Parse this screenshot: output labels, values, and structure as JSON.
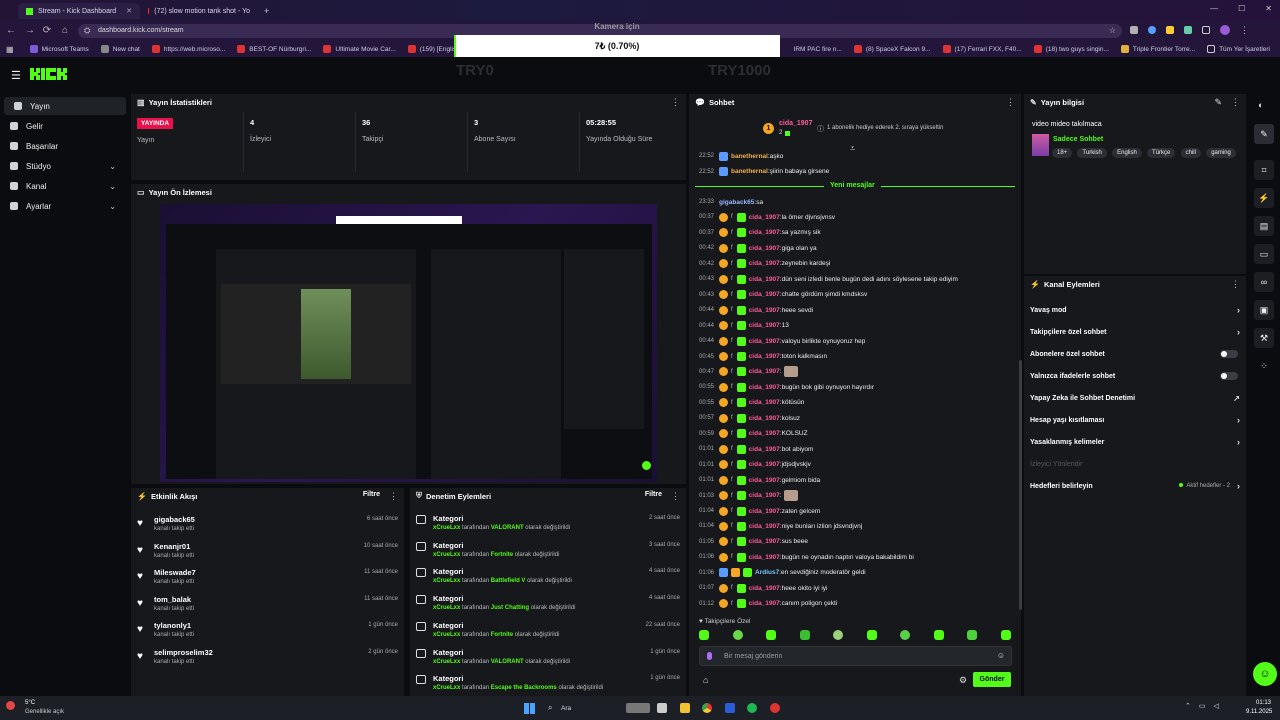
{
  "browser": {
    "tabs": [
      {
        "label": "Stream - Kick Dashboard",
        "active": true
      },
      {
        "label": "(72) slow motion tank shot - Yo",
        "active": false
      }
    ],
    "new_tab_label": "+",
    "url": "dashboard.kick.com/stream",
    "bookmarks": [
      "Microsoft Teams",
      "New chat",
      "https://web.microso...",
      "BEST-OF Nürburgri...",
      "Ultimate Movie Car...",
      "(159) [EnglishSUB]...",
      "IRM PAC fire n...",
      "(8) SpaceX Falcon 9...",
      "(17) Ferrari FXX, F40...",
      "(18) two guys singin...",
      "Triple Frontier Torre..."
    ],
    "all_bookmarks": "Tüm Yer İşaretleri"
  },
  "overlay": {
    "goal_label": "Kamera için",
    "goal_value": "7₺ (0.70%)",
    "goal_progress_fraction": 0.007,
    "left_amount": "TRY0",
    "right_amount": "TRY1000"
  },
  "sidebar": {
    "items": [
      {
        "label": "Yayın",
        "active": true,
        "has_chevron": false
      },
      {
        "label": "Gelir",
        "active": false,
        "has_chevron": false
      },
      {
        "label": "Başarılar",
        "active": false,
        "has_chevron": false
      },
      {
        "label": "Stüdyo",
        "active": false,
        "has_chevron": true
      },
      {
        "label": "Kanal",
        "active": false,
        "has_chevron": true
      },
      {
        "label": "Ayarlar",
        "active": false,
        "has_chevron": true
      }
    ]
  },
  "stats": {
    "title": "Yayın İstatistikleri",
    "live_badge": "YAYINDA",
    "items": [
      {
        "value": "",
        "label": "Yayın"
      },
      {
        "value": "4",
        "label": "İzleyici"
      },
      {
        "value": "36",
        "label": "Takipçi"
      },
      {
        "value": "3",
        "label": "Abone Sayısı"
      },
      {
        "value": "05:28:55",
        "label": "Yayında Olduğu Süre"
      }
    ]
  },
  "preview": {
    "title": "Yayın Ön İzlemesi"
  },
  "events": {
    "title": "Etkinlik Akışı",
    "filter": "Filtre",
    "items": [
      {
        "name": "gigaback65",
        "action": "kanalı takip etti",
        "time": "6 saat önce"
      },
      {
        "name": "Kenanjr01",
        "action": "kanalı takip etti",
        "time": "10 saat önce"
      },
      {
        "name": "Mileswade7",
        "action": "kanalı takip etti",
        "time": "11 saat önce"
      },
      {
        "name": "tom_balak",
        "action": "kanalı takip etti",
        "time": "11 saat önce"
      },
      {
        "name": "tylanonly1",
        "action": "kanalı takip etti",
        "time": "1 gün önce"
      },
      {
        "name": "selimproselim32",
        "action": "kanalı takip etti",
        "time": "2 gün önce"
      }
    ]
  },
  "moderation": {
    "title": "Denetim Eylemleri",
    "filter": "Filtre",
    "items": [
      {
        "title": "Kategori",
        "user": "xCrueLxx",
        "mid": "tarafından",
        "game": "VALORANT",
        "tail": "olarak değiştirildi",
        "time": "2 saat önce"
      },
      {
        "title": "Kategori",
        "user": "xCrueLxx",
        "mid": "tarafından",
        "game": "Fortnite",
        "tail": "olarak değiştirildi",
        "time": "3 saat önce"
      },
      {
        "title": "Kategori",
        "user": "xCrueLxx",
        "mid": "tarafından",
        "game": "Battlefield V",
        "tail": "olarak değiştirildi",
        "time": "4 saat önce"
      },
      {
        "title": "Kategori",
        "user": "xCrueLxx",
        "mid": "tarafından",
        "game": "Just Chatting",
        "tail": "olarak değiştirildi",
        "time": "4 saat önce"
      },
      {
        "title": "Kategori",
        "user": "xCrueLxx",
        "mid": "tarafından",
        "game": "Fortnite",
        "tail": "olarak değiştirildi",
        "time": "22 saat önce"
      },
      {
        "title": "Kategori",
        "user": "xCrueLxx",
        "mid": "tarafından",
        "game": "VALORANT",
        "tail": "olarak değiştirildi",
        "time": "1 gün önce"
      },
      {
        "title": "Kategori",
        "user": "xCrueLxx",
        "mid": "tarafından",
        "game": "Escape the Backrooms",
        "tail": "olarak değiştirildi",
        "time": "1 gün önce"
      }
    ]
  },
  "chat": {
    "title": "Sohbet",
    "pinned_user": "cida_1907",
    "pinned_count": "2",
    "pinned_text": "1 abonelik hediye ederek 2. sıraya yükseltin",
    "new_messages": "Yeni mesajlar",
    "messages": [
      {
        "time": "22:52",
        "user": "banethernal",
        "text": "aşko",
        "style": "u2"
      },
      {
        "time": "22:52",
        "user": "banethernal",
        "text": "şiirin babaya girsene",
        "style": "u2"
      },
      {
        "time": "23:33",
        "user": "gigaback65",
        "text": "sa",
        "style": "u3"
      },
      {
        "time": "00:37",
        "user": "cida_1907",
        "text": "la ömer djvnsjvnsv",
        "style": "u1"
      },
      {
        "time": "00:37",
        "user": "cida_1907",
        "text": "sa yazmış sik",
        "style": "u1"
      },
      {
        "time": "00:42",
        "user": "cida_1907",
        "text": "giga olan ya",
        "style": "u1"
      },
      {
        "time": "00:42",
        "user": "cida_1907",
        "text": "zeynebin kardeşi",
        "style": "u1"
      },
      {
        "time": "00:43",
        "user": "cida_1907",
        "text": "dün seni izledi benle bugün dedi adını söylesene takip ediyim",
        "style": "u1"
      },
      {
        "time": "00:43",
        "user": "cida_1907",
        "text": "chatte gördüm şimdi kmdsksv",
        "style": "u1"
      },
      {
        "time": "00:44",
        "user": "cida_1907",
        "text": "heee sevdi",
        "style": "u1"
      },
      {
        "time": "00:44",
        "user": "cida_1907",
        "text": "13",
        "style": "u1"
      },
      {
        "time": "00:44",
        "user": "cida_1907",
        "text": "valoyu birlikte oynuyoruz hep",
        "style": "u1"
      },
      {
        "time": "00:45",
        "user": "cida_1907",
        "text": "toton kalkmasın",
        "style": "u1"
      },
      {
        "time": "00:47",
        "user": "cida_1907",
        "text": "",
        "style": "u1",
        "emote": true
      },
      {
        "time": "00:55",
        "user": "cida_1907",
        "text": "bugün bok gibi oynuyon hayırdır",
        "style": "u1"
      },
      {
        "time": "00:55",
        "user": "cida_1907",
        "text": "kötüsün",
        "style": "u1"
      },
      {
        "time": "00:57",
        "user": "cida_1907",
        "text": "kolsuz",
        "style": "u1"
      },
      {
        "time": "00:59",
        "user": "cida_1907",
        "text": "KOLSUZ",
        "style": "u1"
      },
      {
        "time": "01:01",
        "user": "cida_1907",
        "text": "bot abiyom",
        "style": "u1"
      },
      {
        "time": "01:01",
        "user": "cida_1907",
        "text": "jdjsdjvskjv",
        "style": "u1"
      },
      {
        "time": "01:01",
        "user": "cida_1907",
        "text": "gelmiom bida",
        "style": "u1"
      },
      {
        "time": "01:03",
        "user": "cida_1907",
        "text": "",
        "style": "u1",
        "emote": true
      },
      {
        "time": "01:04",
        "user": "cida_1907",
        "text": "zaten gelcem",
        "style": "u1"
      },
      {
        "time": "01:04",
        "user": "cida_1907",
        "text": "niye bunları izlion jdsvndjvnj",
        "style": "u1"
      },
      {
        "time": "01:05",
        "user": "cida_1907",
        "text": "sus beee",
        "style": "u1"
      },
      {
        "time": "01:06",
        "user": "cida_1907",
        "text": "bugün ne oynadın naptın valoya bakabildim bi",
        "style": "u1"
      },
      {
        "time": "01:06",
        "user": "Ardius7",
        "text": "en sevdiğiniz moderatör geldi",
        "style": "u4"
      },
      {
        "time": "01:07",
        "user": "cida_1907",
        "text": "heee okito iyi iyi",
        "style": "u1"
      },
      {
        "time": "01:12",
        "user": "cida_1907",
        "text": "canım poligon çekti",
        "style": "u1"
      }
    ],
    "followers_only": "Takipçilere Özel",
    "input_placeholder": "Bir mesaj gönderin",
    "send_label": "Gönder"
  },
  "stream_info": {
    "title": "Yayın bilgisi",
    "stream_title": "video mideo takılmaca",
    "category": "Sadece Sohbet",
    "tags": [
      "18+",
      "Turkish",
      "English",
      "Türkçe",
      "chill",
      "gaming"
    ]
  },
  "channel_actions": {
    "title": "Kanal Eylemleri",
    "items": [
      {
        "label": "Yavaş mod",
        "kind": "chevron"
      },
      {
        "label": "Takipçilere özel sohbet",
        "kind": "chevron"
      },
      {
        "label": "Abonelere özel sohbet",
        "kind": "toggle"
      },
      {
        "label": "Yalnızca ifadelerle sohbet",
        "kind": "toggle"
      },
      {
        "label": "Yapay Zeka ile Sohbet Denetimi",
        "kind": "external"
      },
      {
        "label": "Hesap yaşı kısıtlaması",
        "kind": "chevron"
      },
      {
        "label": "Yasaklanmış kelimeler",
        "kind": "chevron"
      },
      {
        "label": "İzleyici Yönlendir",
        "kind": "disabled"
      },
      {
        "label": "Hedefleri belirleyin",
        "kind": "goal"
      }
    ],
    "goal_status": "Aktif hedefler - 2"
  },
  "taskbar": {
    "weather_temp": "5°C",
    "weather_text": "Genellikle açık",
    "search_label": "Ara",
    "time": "01:13",
    "date": "9.11.2025"
  },
  "colors": {
    "accent": "#53fc18",
    "live": "#e9114c",
    "bg": "#0b0c0f",
    "panel": "#16181c"
  }
}
